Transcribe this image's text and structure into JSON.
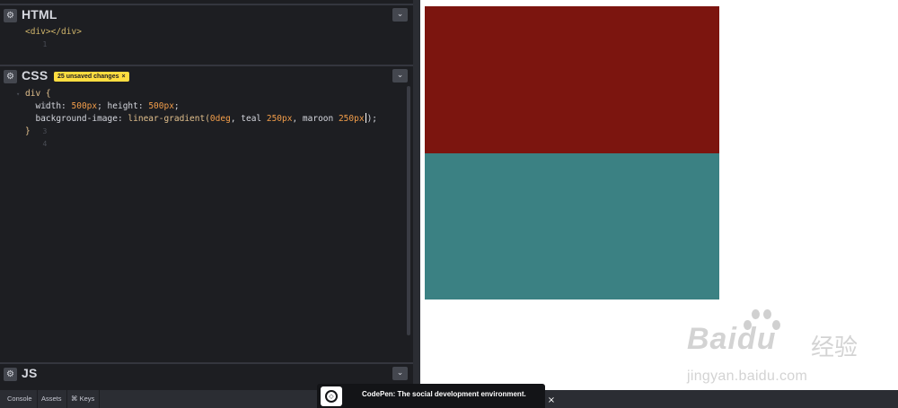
{
  "html_pane": {
    "title": "HTML",
    "gear_icon": "⚙",
    "toggle_icon": "⌄",
    "lines": [
      {
        "number": "1",
        "code": "<div></div>"
      }
    ]
  },
  "css_pane": {
    "title": "CSS",
    "gear_icon": "⚙",
    "toggle_icon": "⌄",
    "badge": "25 unsaved changes",
    "badge_close": "×",
    "line_numbers": [
      "1",
      "2",
      "3",
      "4"
    ],
    "code": {
      "selector": "div {",
      "width_prop": "width: ",
      "width_val": "500px",
      "height_prop": "; height: ",
      "height_val": "500px",
      "semi": ";",
      "bg_prop": "background-image: ",
      "bg_fn": "linear-gradient(",
      "deg": "0deg",
      "sep1": ", teal ",
      "px1": "250px",
      "sep2": ", maroon ",
      "px2": "250px",
      "end": ");",
      "close": "}"
    }
  },
  "js_pane": {
    "title": "JS",
    "gear_icon": "⚙",
    "toggle_icon": "⌄"
  },
  "bottom_bar": {
    "console": "Console",
    "assets": "Assets",
    "keys": "⌘ Keys"
  },
  "promo": {
    "text": "CodePen: The social development environment.",
    "logo_glyph": "◇",
    "close": "×"
  },
  "preview": {
    "top_color": "#7c150f",
    "bottom_color": "#3b8183"
  },
  "watermark": {
    "brand": "Bai",
    "brand2": "du",
    "cn": "经验",
    "url": "jingyan.baidu.com"
  }
}
